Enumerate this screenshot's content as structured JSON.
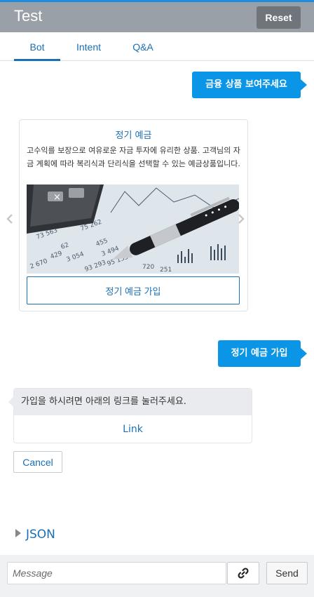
{
  "header": {
    "title": "Test",
    "reset_label": "Reset"
  },
  "tabs": [
    {
      "label": "Bot",
      "active": true
    },
    {
      "label": "Intent",
      "active": false
    },
    {
      "label": "Q&A",
      "active": false
    }
  ],
  "messages": {
    "user_1": "금융 상품 보여주세요",
    "card": {
      "title": "정기 예금",
      "description": "고수익를 보장으로 여유로운 자금 투자에 유리한 상품. 고객님의 자금 계획에 따라 복리식과 단리식을 선택할 수 있는 예금상품입니다.",
      "button_label": "정기 예금 가입"
    },
    "user_2": "정기 예금 가입",
    "bot_text": "가입을 하시려면 아래의 링크를 눌러주세요.",
    "bot_link": "Link",
    "cancel_label": "Cancel"
  },
  "json_toggle_label": "JSON",
  "composer": {
    "placeholder": "Message",
    "send_label": "Send"
  },
  "colors": {
    "accent": "#1a6fb5",
    "user_bubble": "#0a95e6",
    "header_bg": "#9aa0a8",
    "top_border": "#1f8ce0"
  },
  "icons": {
    "carousel_prev": "chevron-left-icon",
    "carousel_next": "chevron-right-icon",
    "attach": "link-icon",
    "json_toggle": "triangle-right-icon"
  }
}
